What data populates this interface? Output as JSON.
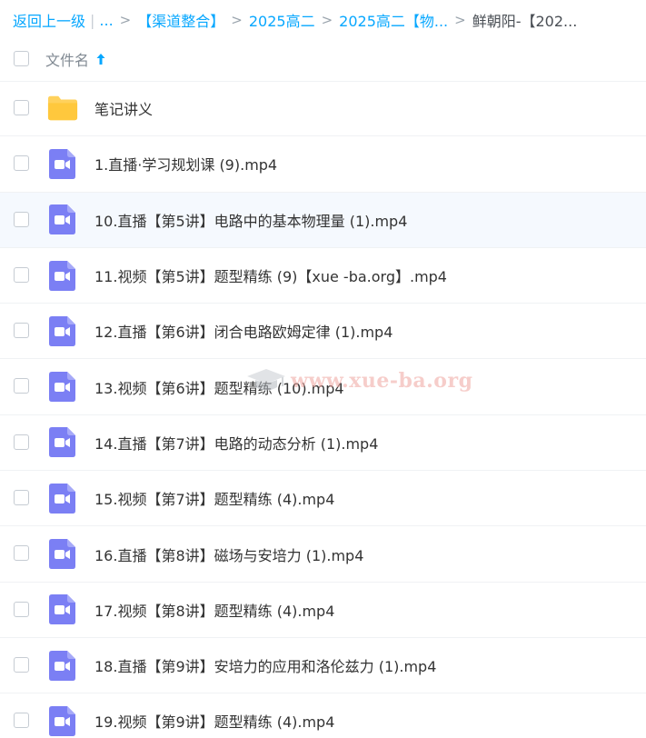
{
  "breadcrumb": {
    "back": "返回上一级",
    "ellipsis": "...",
    "items": [
      "【渠道整合】",
      "2025高二",
      "2025高二【物..."
    ],
    "current": "鲜朝阳-【202..."
  },
  "header": {
    "column_label": "文件名",
    "sort_icon": "arrow-up-icon"
  },
  "files": [
    {
      "name": "笔记讲义",
      "type": "folder"
    },
    {
      "name": "1.直播·学习规划课 (9).mp4",
      "type": "video"
    },
    {
      "name": "10.直播【第5讲】电路中的基本物理量 (1).mp4",
      "type": "video"
    },
    {
      "name": "11.视频【第5讲】题型精练 (9)【xue -ba.org】.mp4",
      "type": "video"
    },
    {
      "name": "12.直播【第6讲】闭合电路欧姆定律 (1).mp4",
      "type": "video"
    },
    {
      "name": "13.视频【第6讲】题型精练 (10).mp4",
      "type": "video"
    },
    {
      "name": "14.直播【第7讲】电路的动态分析 (1).mp4",
      "type": "video"
    },
    {
      "name": "15.视频【第7讲】题型精练 (4).mp4",
      "type": "video"
    },
    {
      "name": "16.直播【第8讲】磁场与安培力 (1).mp4",
      "type": "video"
    },
    {
      "name": "17.视频【第8讲】题型精练 (4).mp4",
      "type": "video"
    },
    {
      "name": "18.直播【第9讲】安培力的应用和洛伦兹力 (1).mp4",
      "type": "video"
    },
    {
      "name": "19.视频【第9讲】题型精练 (4).mp4",
      "type": "video"
    }
  ],
  "watermark": {
    "text": "www.xue-ba.org",
    "icon": "graduation-cap-icon"
  },
  "colors": {
    "link": "#06a7ff",
    "folder": "#ffd15c",
    "video": "#7b7ff4",
    "row_hover": "#f5f9fe"
  }
}
